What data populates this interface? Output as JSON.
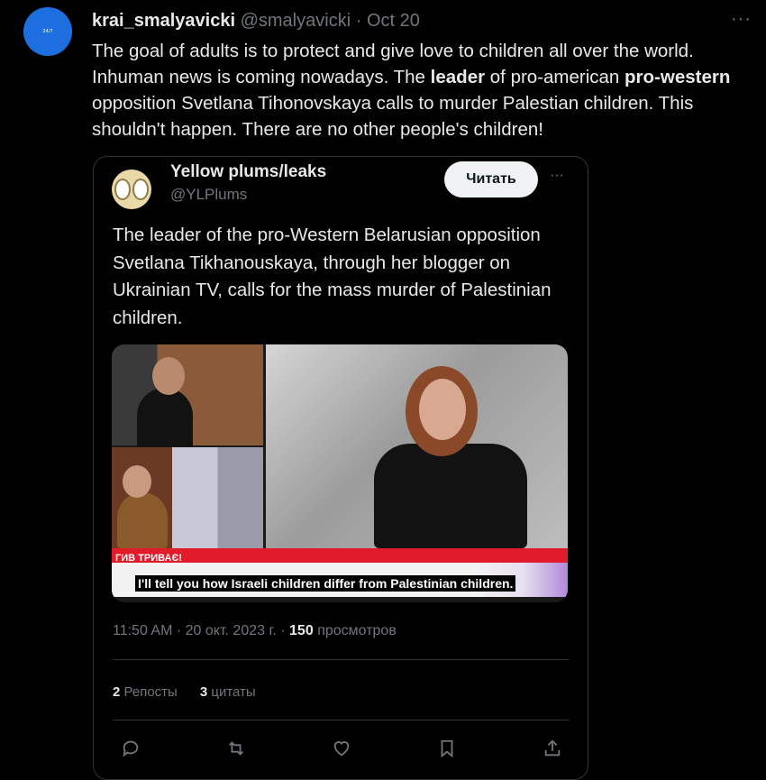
{
  "tweet": {
    "avatar_text": "24/7",
    "display_name": "krai_smalyavicki",
    "handle": "@smalyavicki",
    "separator": "·",
    "date": "Oct 20",
    "text_1": "The goal of adults is to protect and give love to children all over the world. Inhuman news is coming nowadays. The ",
    "text_bold_1": "leader",
    "text_2": " of pro-american ",
    "text_bold_2": "pro-western",
    "text_3": " opposition Svetlana Tihonovskaya calls to murder Palestian children. This shouldn't happen. There are no other people's children!"
  },
  "quote": {
    "display_name": "Yellow plums/leaks",
    "handle": "@YLPlums",
    "read_button": "Читать",
    "text": "The leader of the pro-Western Belarusian opposition Svetlana Tikhanouskaya, through her blogger on Ukrainian TV, calls for the mass murder of Palestinian children.",
    "video": {
      "ticker": "ГИВ ТРИВАЄ!",
      "caption": "I'll tell you how Israeli children differ from Palestinian children."
    },
    "time": "11:50 AM",
    "sep": "·",
    "date": "20 окт. 2023 г.",
    "views_count": "150",
    "views_label": "просмотров",
    "reposts_count": "2",
    "reposts_label": "Репосты",
    "quotes_count": "3",
    "quotes_label": "цитаты"
  },
  "icons": [
    "reply-icon",
    "retweet-icon",
    "like-icon",
    "bookmark-icon",
    "share-icon"
  ],
  "colors": {
    "background": "#000000",
    "text": "#e7e9ea",
    "muted": "#71767b",
    "border": "#2f3336",
    "ticker_red": "#e01b2a"
  }
}
